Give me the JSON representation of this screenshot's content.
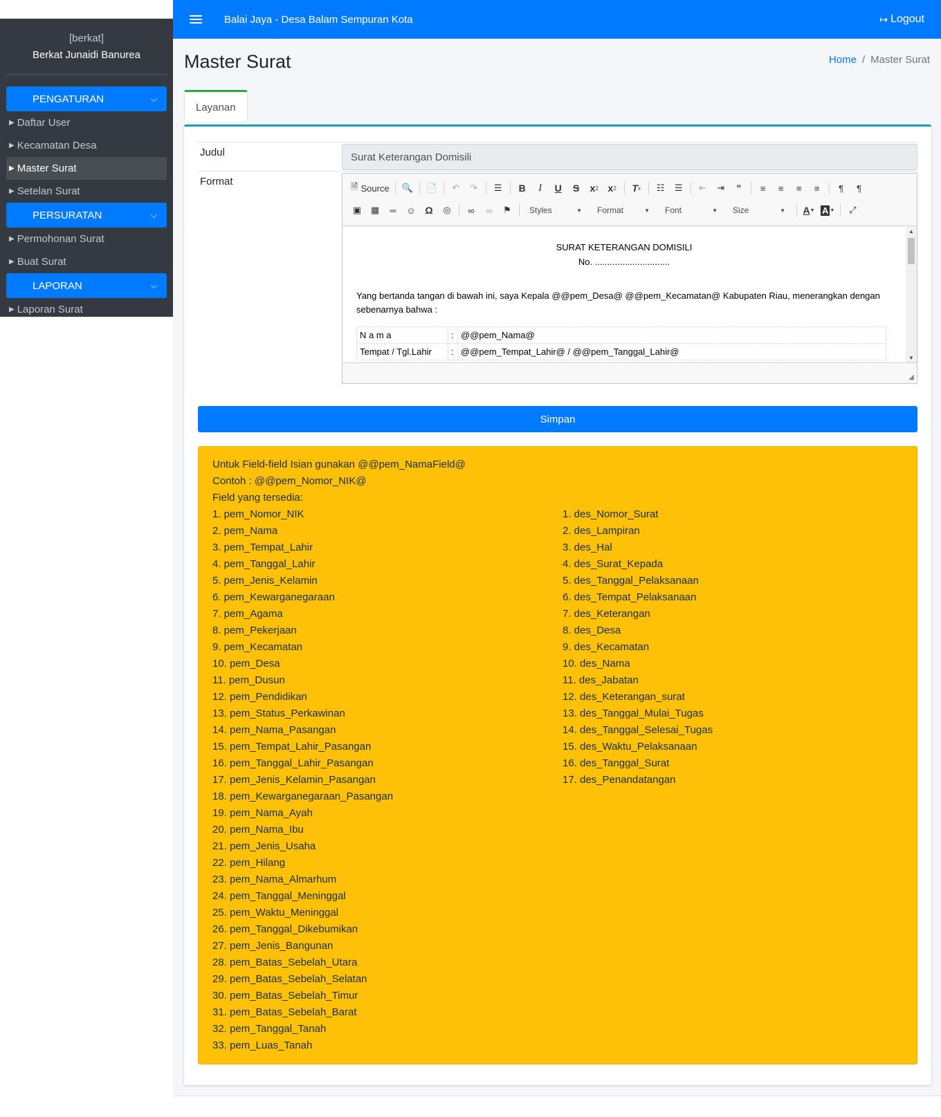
{
  "sidebar": {
    "user_role": "[berkat]",
    "user_name": "Berkat Junaidi Banurea",
    "sections": {
      "pengaturan": "PENGATURAN",
      "persuratan": "PERSURATAN",
      "laporan": "LAPORAN"
    },
    "items": {
      "daftar_user": "Daftar User",
      "kecamatan_desa": "Kecamatan Desa",
      "master_surat": "Master Surat",
      "setelan_surat": "Setelan Surat",
      "permohonan_surat": "Permohonan Surat",
      "buat_surat": "Buat Surat",
      "laporan_surat": "Laporan Surat"
    },
    "active_item": "Master Surat"
  },
  "topbar": {
    "title": "Balai Jaya - Desa Balam Sempuran Kota",
    "logout": "Logout"
  },
  "page": {
    "title": "Master Surat",
    "breadcrumb": {
      "home": "Home",
      "separator": "/",
      "current": "Master Surat"
    },
    "tab": "Layanan"
  },
  "form": {
    "judul_label": "Judul",
    "judul_value": "Surat Keterangan Domisili",
    "format_label": "Format",
    "submit": "Simpan"
  },
  "editor": {
    "toolbar": {
      "source": "Source",
      "styles": "Styles",
      "format": "Format",
      "font": "Font",
      "size": "Size"
    },
    "content": {
      "title": "SURAT KETERANGAN DOMISILI",
      "number": "No. ..............................",
      "paragraph": "Yang bertanda tangan di bawah ini, saya Kepala @@pem_Desa@ @@pem_Kecamatan@ Kabupaten Riau, menerangkan dengan sebenarnya bahwa :",
      "rows": [
        {
          "label": "N a m a",
          "colon": ":",
          "value": "@@pem_Nama@"
        },
        {
          "label": "Tempat / Tgl.Lahir",
          "colon": ":",
          "value": "@@pem_Tempat_Lahir@ / @@pem_Tanggal_Lahir@"
        }
      ]
    }
  },
  "info": {
    "line1": "Untuk Field-field Isian gunakan @@pem_NamaField@",
    "line2": "Contoh : @@pem_Nomor_NIK@",
    "line3": "Field yang tersedia:",
    "pem_fields": [
      "1. pem_Nomor_NIK",
      "2. pem_Nama",
      "3. pem_Tempat_Lahir",
      "4. pem_Tanggal_Lahir",
      "5. pem_Jenis_Kelamin",
      "6. pem_Kewarganegaraan",
      "7. pem_Agama",
      "8. pem_Pekerjaan",
      "9. pem_Kecamatan",
      "10. pem_Desa",
      "11. pem_Dusun",
      "12. pem_Pendidikan",
      "13. pem_Status_Perkawinan",
      "14. pem_Nama_Pasangan",
      "15. pem_Tempat_Lahir_Pasangan",
      "16. pem_Tanggal_Lahir_Pasangan",
      "17. pem_Jenis_Kelamin_Pasangan",
      "18. pem_Kewarganegaraan_Pasangan",
      "19. pem_Nama_Ayah",
      "20. pem_Nama_Ibu",
      "21. pem_Jenis_Usaha",
      "22. pem_Hilang",
      "23. pem_Nama_Almarhum",
      "24. pem_Tanggal_Meninggal",
      "25. pem_Waktu_Meninggal",
      "26. pem_Tanggal_Dikebumikan",
      "27. pem_Jenis_Bangunan",
      "28. pem_Batas_Sebelah_Utara",
      "29. pem_Batas_Sebelah_Selatan",
      "30. pem_Batas_Sebelah_Timur",
      "31. pem_Batas_Sebelah_Barat",
      "32. pem_Tanggal_Tanah",
      "33. pem_Luas_Tanah"
    ],
    "des_fields": [
      "1. des_Nomor_Surat",
      "2. des_Lampiran",
      "3. des_Hal",
      "4. des_Surat_Kepada",
      "5. des_Tanggal_Pelaksanaan",
      "6. des_Tempat_Pelaksanaan",
      "7. des_Keterangan",
      "8. des_Desa",
      "9. des_Kecamatan",
      "10. des_Nama",
      "11. des_Jabatan",
      "12. des_Keterangan_surat",
      "13. des_Tanggal_Mulai_Tugas",
      "14. des_Tanggal_Selesai_Tugas",
      "15. des_Waktu_Pelaksanaan",
      "16. des_Tanggal_Surat",
      "17. des_Penandatangan"
    ]
  },
  "colors": {
    "primary": "#007bff",
    "sidebar": "#343a40",
    "warning": "#ffc107",
    "tab_accent": "#28a745",
    "card_accent": "#17a2b8"
  }
}
